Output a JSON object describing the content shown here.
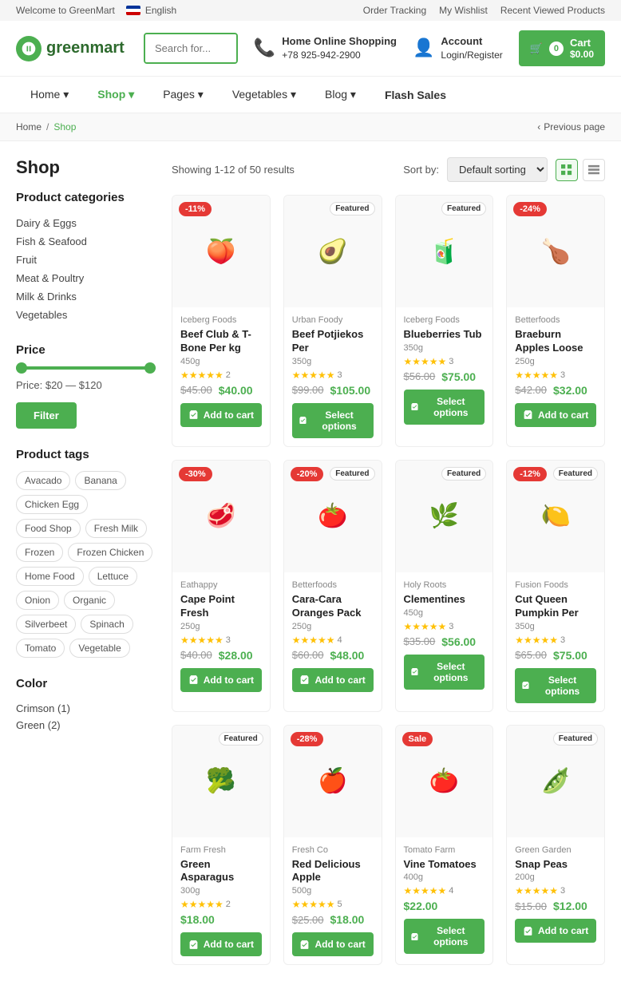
{
  "topbar": {
    "welcome": "Welcome to GreenMart",
    "language": "English",
    "links": [
      "Order Tracking",
      "My Wishlist",
      "Recent Viewed Products"
    ]
  },
  "header": {
    "logo_text": "greenmart",
    "search_placeholder": "Search for...",
    "phone_label": "Home Online Shopping",
    "phone_number": "+78 925-942-2900",
    "account_label": "Account",
    "account_sub": "Login/Register",
    "cart_label": "Cart",
    "cart_amount": "$0.00",
    "cart_count": "0"
  },
  "nav": {
    "items": [
      {
        "label": "Home",
        "active": false,
        "has_arrow": true
      },
      {
        "label": "Shop",
        "active": true,
        "has_arrow": true
      },
      {
        "label": "Pages",
        "active": false,
        "has_arrow": true
      },
      {
        "label": "Vegetables",
        "active": false,
        "has_arrow": true
      },
      {
        "label": "Blog",
        "active": false,
        "has_arrow": true
      },
      {
        "label": "Flash Sales",
        "active": false,
        "has_arrow": false
      }
    ]
  },
  "breadcrumb": {
    "home": "Home",
    "current": "Shop",
    "prev_page": "Previous page"
  },
  "page": {
    "title": "Shop",
    "results_text": "Showing 1-12 of 50 results",
    "sort_label": "Sort by:",
    "sort_default": "Default sorting"
  },
  "sidebar": {
    "categories_title": "Product categories",
    "categories": [
      "Dairy & Eggs",
      "Fish & Seafood",
      "Fruit",
      "Meat & Poultry",
      "Milk & Drinks",
      "Vegetables"
    ],
    "price_title": "Price",
    "price_range": "Price: $20 — $120",
    "filter_label": "Filter",
    "tags_title": "Product tags",
    "tags": [
      "Avacado",
      "Banana",
      "Chicken Egg",
      "Food Shop",
      "Fresh Milk",
      "Frozen",
      "Frozen Chicken",
      "Home Food",
      "Lettuce",
      "Onion",
      "Organic",
      "Silverbeet",
      "Spinach",
      "Tomato",
      "Vegetable"
    ],
    "color_title": "Color",
    "colors": [
      "Crimson (1)",
      "Green (2)"
    ]
  },
  "products": [
    {
      "brand": "Iceberg Foods",
      "name": "Beef Club & T-Bone Per kg",
      "weight": "450g",
      "stars": 5,
      "reviews": 2,
      "price_old": "$45.00",
      "price_new": "$40.00",
      "discount": "-11%",
      "featured": false,
      "button_type": "add",
      "button_label": "Add to cart",
      "emoji": "🍑"
    },
    {
      "brand": "Urban Foody",
      "name": "Beef Potjiekos Per",
      "weight": "350g",
      "stars": 5,
      "reviews": 3,
      "price_old": "$99.00",
      "price_new": "$105.00",
      "discount": "",
      "featured": true,
      "button_type": "select",
      "button_label": "Select options",
      "emoji": "🥑"
    },
    {
      "brand": "Iceberg Foods",
      "name": "Blueberries Tub",
      "weight": "350g",
      "stars": 5,
      "reviews": 3,
      "price_old": "$56.00",
      "price_new": "$75.00",
      "discount": "",
      "featured": true,
      "button_type": "select",
      "button_label": "Select options",
      "emoji": "🧃"
    },
    {
      "brand": "Betterfoods",
      "name": "Braeburn Apples Loose",
      "weight": "250g",
      "stars": 5,
      "reviews": 3,
      "price_old": "$42.00",
      "price_new": "$32.00",
      "discount": "-24%",
      "featured": false,
      "button_type": "add",
      "button_label": "Add to cart",
      "emoji": "🍗"
    },
    {
      "brand": "Eathappy",
      "name": "Cape Point Fresh",
      "weight": "250g",
      "stars": 5,
      "reviews": 3,
      "price_old": "$40.00",
      "price_new": "$28.00",
      "discount": "-30%",
      "featured": false,
      "button_type": "add",
      "button_label": "Add to cart",
      "emoji": "🥩"
    },
    {
      "brand": "Betterfoods",
      "name": "Cara-Cara Oranges Pack",
      "weight": "250g",
      "stars": 5,
      "reviews": 4,
      "price_old": "$60.00",
      "price_new": "$48.00",
      "discount": "-20%",
      "featured": true,
      "button_type": "add",
      "button_label": "Add to cart",
      "emoji": "🍅"
    },
    {
      "brand": "Holy Roots",
      "name": "Clementines",
      "weight": "450g",
      "stars": 5,
      "reviews": 3,
      "price_old": "$35.00",
      "price_new": "$56.00",
      "discount": "",
      "featured": true,
      "button_type": "select",
      "button_label": "Select options",
      "emoji": "🌿"
    },
    {
      "brand": "Fusion Foods",
      "name": "Cut Queen Pumpkin Per",
      "weight": "350g",
      "stars": 5,
      "reviews": 3,
      "price_old": "$65.00",
      "price_new": "$75.00",
      "discount": "-12%",
      "featured": true,
      "button_type": "select",
      "button_label": "Select options",
      "emoji": "🍋"
    },
    {
      "brand": "Farm Fresh",
      "name": "Green Asparagus",
      "weight": "300g",
      "stars": 5,
      "reviews": 2,
      "price_old": "",
      "price_new": "$18.00",
      "discount": "",
      "featured": true,
      "button_type": "add",
      "button_label": "Add to cart",
      "emoji": "🥦"
    },
    {
      "brand": "Fresh Co",
      "name": "Red Delicious Apple",
      "weight": "500g",
      "stars": 5,
      "reviews": 5,
      "price_old": "$25.00",
      "price_new": "$18.00",
      "discount": "-28%",
      "featured": false,
      "button_type": "add",
      "button_label": "Add to cart",
      "emoji": "🍎"
    },
    {
      "brand": "Tomato Farm",
      "name": "Vine Tomatoes",
      "weight": "400g",
      "stars": 5,
      "reviews": 4,
      "price_old": "",
      "price_new": "$22.00",
      "discount": "Sale",
      "featured": false,
      "button_type": "select",
      "button_label": "Select options",
      "emoji": "🍅"
    },
    {
      "brand": "Green Garden",
      "name": "Snap Peas",
      "weight": "200g",
      "stars": 5,
      "reviews": 3,
      "price_old": "$15.00",
      "price_new": "$12.00",
      "discount": "",
      "featured": true,
      "button_type": "add",
      "button_label": "Add to cart",
      "emoji": "🫛"
    }
  ]
}
